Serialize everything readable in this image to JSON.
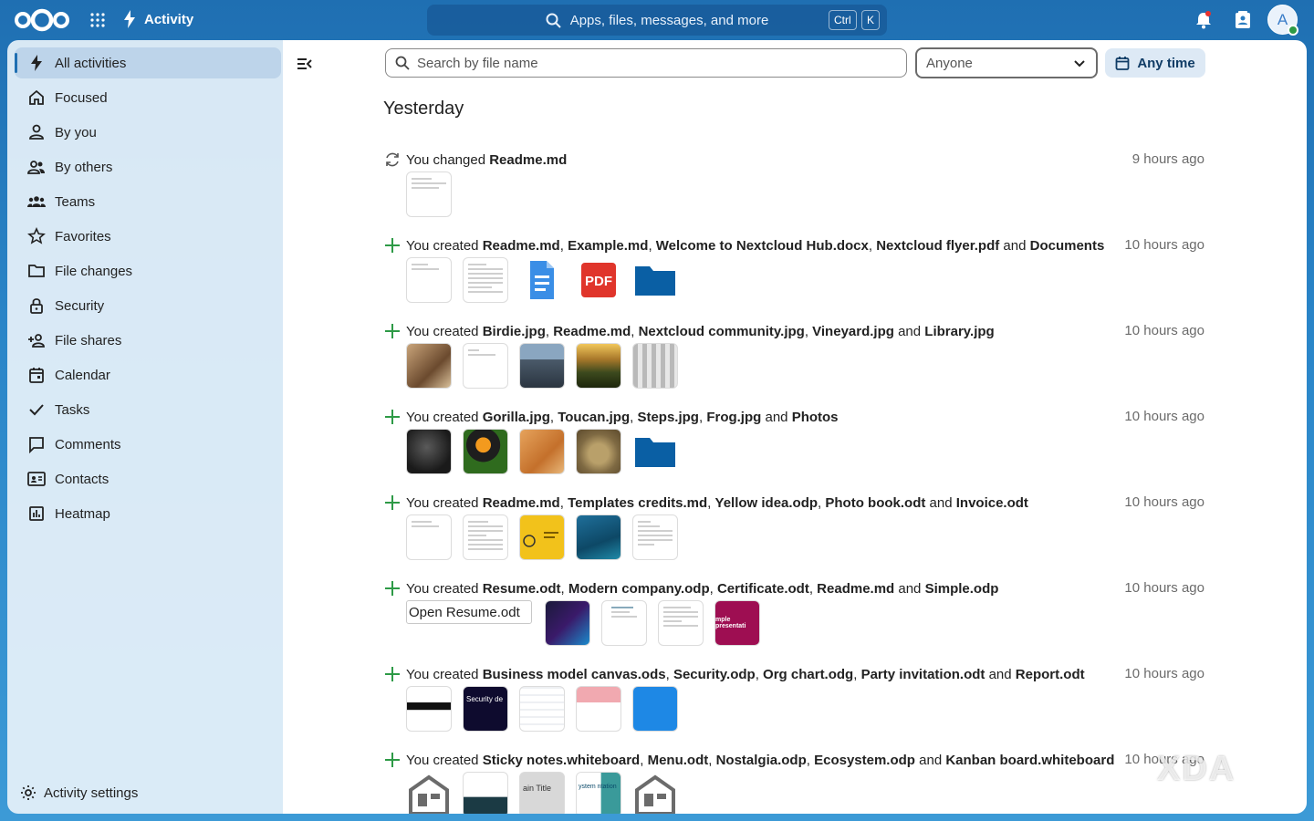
{
  "header": {
    "app_name": "Activity",
    "search_placeholder": "Apps, files, messages, and more",
    "kbd_ctrl": "Ctrl",
    "kbd_k": "K",
    "avatar_letter": "A"
  },
  "sidebar": {
    "items": [
      {
        "label": "All activities",
        "icon": "lightning-icon"
      },
      {
        "label": "Focused",
        "icon": "home-icon"
      },
      {
        "label": "By you",
        "icon": "user-icon"
      },
      {
        "label": "By others",
        "icon": "users-icon"
      },
      {
        "label": "Teams",
        "icon": "team-icon"
      },
      {
        "label": "Favorites",
        "icon": "star-icon"
      },
      {
        "label": "File changes",
        "icon": "folder-icon"
      },
      {
        "label": "Security",
        "icon": "lock-icon"
      },
      {
        "label": "File shares",
        "icon": "share-user-icon"
      },
      {
        "label": "Calendar",
        "icon": "calendar-icon"
      },
      {
        "label": "Tasks",
        "icon": "check-icon"
      },
      {
        "label": "Comments",
        "icon": "comment-icon"
      },
      {
        "label": "Contacts",
        "icon": "contacts-icon"
      },
      {
        "label": "Heatmap",
        "icon": "heatmap-icon"
      }
    ],
    "settings_label": "Activity settings"
  },
  "filters": {
    "file_search_placeholder": "Search by file name",
    "person_filter": "Anyone",
    "time_filter": "Any time"
  },
  "day_heading": "Yesterday",
  "activities": [
    {
      "prefix": "You changed ",
      "files": [
        "Readme.md"
      ],
      "time": "9 hours ago",
      "type": "changed"
    },
    {
      "prefix": "You created ",
      "files": [
        "Readme.md",
        "Example.md",
        "Welcome to Nextcloud Hub.docx",
        "Nextcloud flyer.pdf",
        "Documents"
      ],
      "time": "10 hours ago",
      "type": "created"
    },
    {
      "prefix": "You created ",
      "files": [
        "Birdie.jpg",
        "Readme.md",
        "Nextcloud community.jpg",
        "Vineyard.jpg",
        "Library.jpg"
      ],
      "time": "10 hours ago",
      "type": "created"
    },
    {
      "prefix": "You created ",
      "files": [
        "Gorilla.jpg",
        "Toucan.jpg",
        "Steps.jpg",
        "Frog.jpg",
        "Photos"
      ],
      "time": "10 hours ago",
      "type": "created"
    },
    {
      "prefix": "You created ",
      "files": [
        "Readme.md",
        "Templates credits.md",
        "Yellow idea.odp",
        "Photo book.odt",
        "Invoice.odt"
      ],
      "time": "10 hours ago",
      "type": "created"
    },
    {
      "prefix": "You created ",
      "files": [
        "Resume.odt",
        "Modern company.odp",
        "Certificate.odt",
        "Readme.md",
        "Simple.odp"
      ],
      "time": "10 hours ago",
      "type": "created"
    },
    {
      "prefix": "You created ",
      "files": [
        "Business model canvas.ods",
        "Security.odp",
        "Org chart.odg",
        "Party invitation.odt",
        "Report.odt"
      ],
      "time": "10 hours ago",
      "type": "created"
    },
    {
      "prefix": "You created ",
      "files": [
        "Sticky notes.whiteboard",
        "Menu.odt",
        "Nostalgia.odp",
        "Ecosystem.odp",
        "Kanban board.whiteboard"
      ],
      "time": "10 hours ago",
      "type": "created"
    }
  ],
  "broken_image_alt": "Open Resume.odt",
  "thumb_texts": {
    "pdf": "PDF",
    "security": "Security de",
    "simple": "mple presentati",
    "main_title": "ain Title",
    "ecosystem": "ystem ntation"
  },
  "watermark": "XDA",
  "colors": {
    "header_blue": "#1f6fb2",
    "accent": "#1f6fb2",
    "created_green": "#2d9a46",
    "folder_blue": "#0a5fa4"
  }
}
